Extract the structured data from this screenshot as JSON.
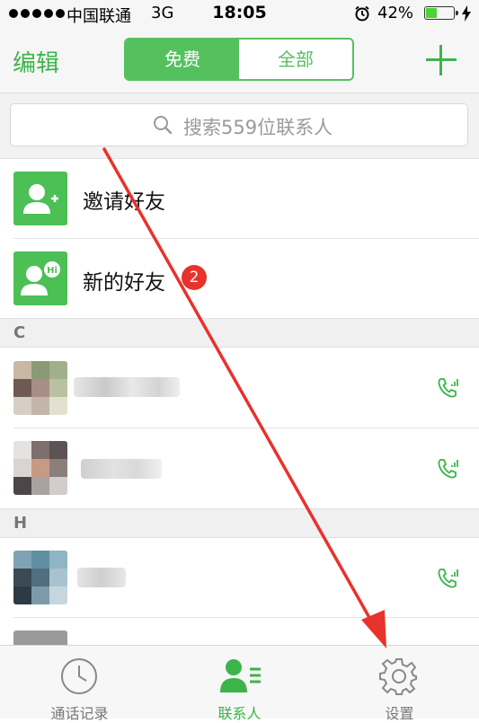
{
  "status_bar": {
    "carrier": "中国联通",
    "network": "3G",
    "time": "18:05",
    "battery": "42%",
    "battery_level": 0.42
  },
  "nav": {
    "edit_label": "编辑",
    "segments": [
      "免费",
      "全部"
    ]
  },
  "search": {
    "placeholder": "搜索559位联系人"
  },
  "actions": [
    {
      "label": "邀请好友",
      "icon": "add-user-icon"
    },
    {
      "label": "新的好友",
      "icon": "new-friend-hi-icon",
      "badge": "2"
    }
  ],
  "sections": [
    {
      "header": "C",
      "contacts": [
        {
          "name": ""
        },
        {
          "name": ""
        }
      ]
    },
    {
      "header": "H",
      "contacts": [
        {
          "name": ""
        },
        {
          "name": ""
        }
      ]
    }
  ],
  "tabs": [
    {
      "label": "通话记录",
      "icon": "clock-icon",
      "active": false
    },
    {
      "label": "联系人",
      "icon": "contacts-icon",
      "active": true
    },
    {
      "label": "设置",
      "icon": "gear-icon",
      "active": false
    }
  ],
  "colors": {
    "accent": "#3cb44a",
    "badge": "#e8322c",
    "arrow": "#e8322c"
  }
}
